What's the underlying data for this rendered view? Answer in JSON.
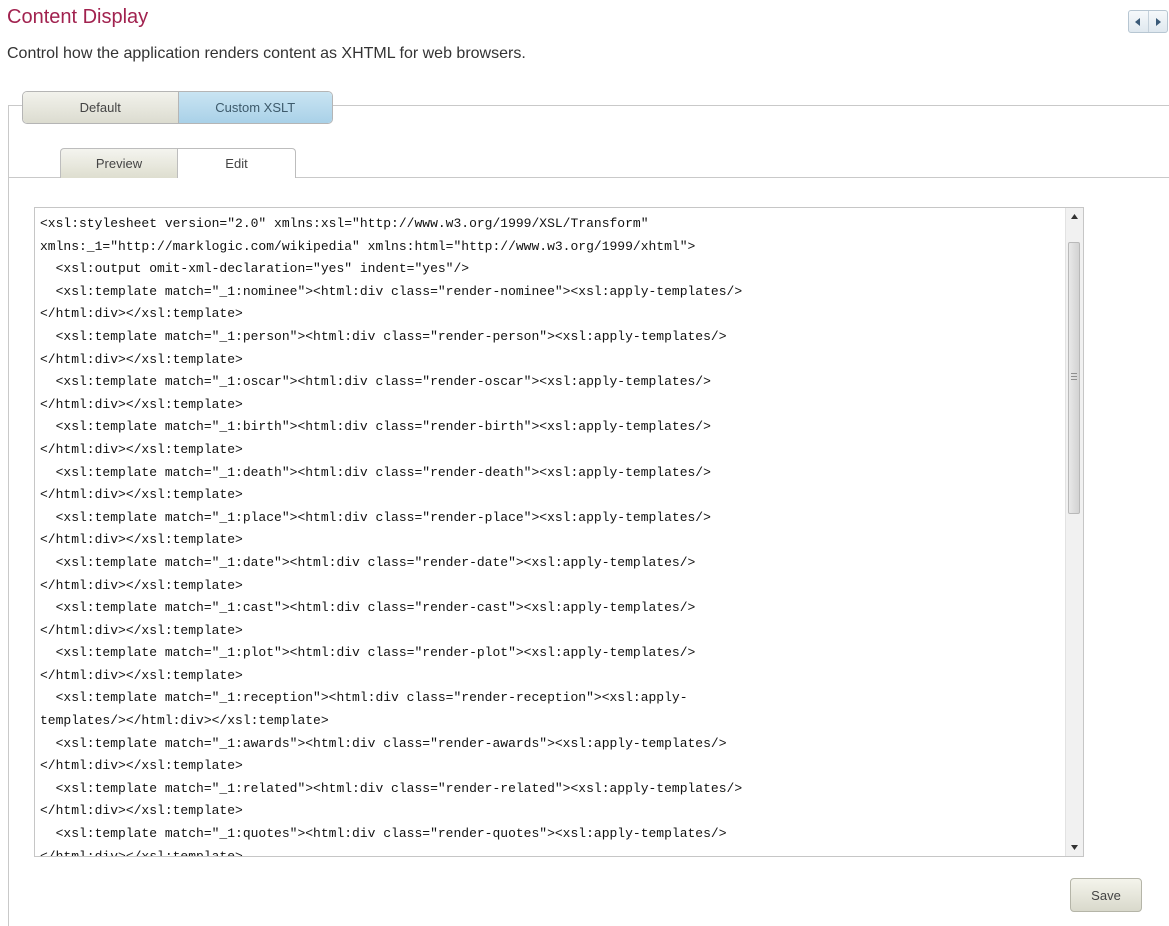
{
  "header": {
    "title": "Content Display",
    "subtitle": "Control how the application renders content as XHTML for web browsers."
  },
  "nav": {
    "prev_icon": "triangle-left",
    "next_icon": "triangle-right"
  },
  "outer_tabs": [
    {
      "label": "Default",
      "active": false
    },
    {
      "label": "Custom XSLT",
      "active": true
    }
  ],
  "inner_tabs": [
    {
      "label": "Preview",
      "active": false
    },
    {
      "label": "Edit",
      "active": true
    }
  ],
  "editor": {
    "lines": [
      "<xsl:stylesheet version=\"2.0\" xmlns:xsl=\"http://www.w3.org/1999/XSL/Transform\"",
      "xmlns:_1=\"http://marklogic.com/wikipedia\" xmlns:html=\"http://www.w3.org/1999/xhtml\">",
      "  <xsl:output omit-xml-declaration=\"yes\" indent=\"yes\"/>",
      "  <xsl:template match=\"_1:nominee\"><html:div class=\"render-nominee\"><xsl:apply-templates/>",
      "</html:div></xsl:template>",
      "  <xsl:template match=\"_1:person\"><html:div class=\"render-person\"><xsl:apply-templates/>",
      "</html:div></xsl:template>",
      "  <xsl:template match=\"_1:oscar\"><html:div class=\"render-oscar\"><xsl:apply-templates/>",
      "</html:div></xsl:template>",
      "  <xsl:template match=\"_1:birth\"><html:div class=\"render-birth\"><xsl:apply-templates/>",
      "</html:div></xsl:template>",
      "  <xsl:template match=\"_1:death\"><html:div class=\"render-death\"><xsl:apply-templates/>",
      "</html:div></xsl:template>",
      "  <xsl:template match=\"_1:place\"><html:div class=\"render-place\"><xsl:apply-templates/>",
      "</html:div></xsl:template>",
      "  <xsl:template match=\"_1:date\"><html:div class=\"render-date\"><xsl:apply-templates/>",
      "</html:div></xsl:template>",
      "  <xsl:template match=\"_1:cast\"><html:div class=\"render-cast\"><xsl:apply-templates/>",
      "</html:div></xsl:template>",
      "  <xsl:template match=\"_1:plot\"><html:div class=\"render-plot\"><xsl:apply-templates/>",
      "</html:div></xsl:template>",
      "  <xsl:template match=\"_1:reception\"><html:div class=\"render-reception\"><xsl:apply-",
      "templates/></html:div></xsl:template>",
      "  <xsl:template match=\"_1:awards\"><html:div class=\"render-awards\"><xsl:apply-templates/>",
      "</html:div></xsl:template>",
      "  <xsl:template match=\"_1:related\"><html:div class=\"render-related\"><xsl:apply-templates/>",
      "</html:div></xsl:template>",
      "  <xsl:template match=\"_1:quotes\"><html:div class=\"render-quotes\"><xsl:apply-templates/>",
      "</html:div></xsl:template>"
    ],
    "scroll_position": 0.0
  },
  "actions": {
    "save_label": "Save"
  }
}
